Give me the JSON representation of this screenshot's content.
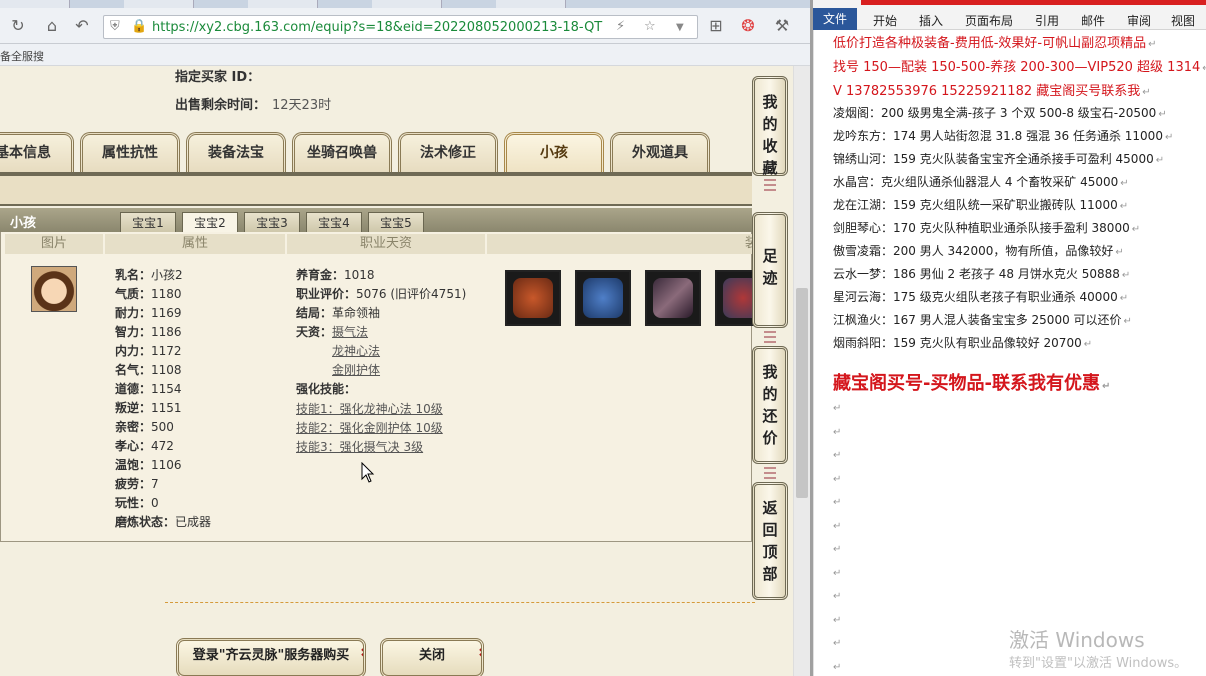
{
  "browser": {
    "url": "https://xy2.cbg.163.com/equip?s=18&eid=202208052000213-18-QT",
    "bookmarks_label": "备全服搜"
  },
  "page": {
    "seller_id_label": "指定买家 ID：",
    "sale_time_label": "出售剩余时间：",
    "sale_time_value": "12天23时",
    "main_tabs": [
      "基本信息",
      "属性抗性",
      "装备法宝",
      "坐骑召唤兽",
      "法术修正",
      "小孩",
      "外观道具"
    ],
    "active_tab": "小孩",
    "child_section_title": "小孩",
    "baby_tabs": [
      "宝宝1",
      "宝宝2",
      "宝宝3",
      "宝宝4",
      "宝宝5"
    ],
    "active_baby_tab": "宝宝2",
    "columns": {
      "picture": "图片",
      "attributes": "属性",
      "career": "职业天资",
      "equipment": "装备"
    },
    "attributes": [
      {
        "label": "乳名：",
        "value": "小孩2"
      },
      {
        "label": "气质：",
        "value": "1180"
      },
      {
        "label": "耐力：",
        "value": "1169"
      },
      {
        "label": "智力：",
        "value": "1186"
      },
      {
        "label": "内力：",
        "value": "1172"
      },
      {
        "label": "名气：",
        "value": "1108"
      },
      {
        "label": "道德：",
        "value": "1154"
      },
      {
        "label": "叛逆：",
        "value": "1151"
      },
      {
        "label": "亲密：",
        "value": "500"
      },
      {
        "label": "孝心：",
        "value": "472"
      },
      {
        "label": "温饱：",
        "value": "1106"
      },
      {
        "label": "疲劳：",
        "value": "7"
      },
      {
        "label": "玩性：",
        "value": "0"
      },
      {
        "label": "磨炼状态：",
        "value": "已成器"
      }
    ],
    "career": {
      "raising_label": "养育金：",
      "raising_value": "1018",
      "rating_label": "职业评价：",
      "rating_value": "5076 (旧评价4751)",
      "ending_label": "结局：",
      "ending_value": "革命领袖",
      "talent_label": "天资：",
      "talents": [
        "摄气法",
        "龙神心法",
        "金刚护体"
      ],
      "skills_label": "强化技能：",
      "skills": [
        "技能1：强化龙神心法 10级",
        "技能2：强化金刚护体 10级",
        "技能3：强化摄气决 3级"
      ]
    },
    "equipment_icons": [
      "armor-icon",
      "robe-icon",
      "instrument-icon",
      "chest-icon"
    ],
    "buttons": {
      "buy": "登录\"齐云灵脉\"服务器购买",
      "close": "关闭"
    },
    "side_buttons": [
      "我的收藏",
      "足迹",
      "我的还价",
      "返回顶部"
    ]
  },
  "word": {
    "ribbon_tabs": [
      "文件",
      "开始",
      "插入",
      "页面布局",
      "引用",
      "邮件",
      "审阅",
      "视图"
    ],
    "lines": [
      {
        "text": "低价打造各种极装备-费用低-效果好-可帆山副忍项精品",
        "style": "red"
      },
      {
        "text": "找号 150—配装 150-500-养孩 200-300—VIP520 超级 1314",
        "style": "red"
      },
      {
        "text": "V 13782553976     15225921182   藏宝阁买号联系我",
        "style": "red"
      },
      {
        "text": "凌烟阁：200 级男鬼全满-孩子 3 个双 500-8 级宝石-20500",
        "style": "normal"
      },
      {
        "text": "龙吟东方：174 男人站街忽混 31.8 强混 36 任务通杀 11000",
        "style": "normal"
      },
      {
        "text": "锦绣山河：159 克火队装备宝宝齐全通杀接手可盈利 45000",
        "style": "normal"
      },
      {
        "text": "水晶宫：克火组队通杀仙器混人 4 个畜牧采矿 45000",
        "style": "normal"
      },
      {
        "text": "龙在江湖：159 克火组队统一采矿职业搬砖队 11000",
        "style": "normal"
      },
      {
        "text": "剑胆琴心：170 克火队种植职业通杀队接手盈利 38000",
        "style": "normal"
      },
      {
        "text": "傲雪凌霜：200 男人 342000，物有所值，品像较好",
        "style": "normal"
      },
      {
        "text": "云水一梦：186 男仙 2 老孩子 48 月饼水克火 50888",
        "style": "normal"
      },
      {
        "text": "星河云海：175 级克火组队老孩子有职业通杀 40000",
        "style": "normal"
      },
      {
        "text": "江枫渔火：167 男人混人装备宝宝多 25000 可以还价",
        "style": "normal"
      },
      {
        "text": "烟雨斜阳：159 克火队有职业品像较好 20700",
        "style": "normal"
      },
      {
        "text": "藏宝阁买号-买物品-联系我有优惠",
        "style": "bigred"
      }
    ],
    "watermark": "激活 Windows",
    "watermark_sub": "转到\"设置\"以激活 Windows。"
  },
  "colors": {
    "accent_red": "#d4161c",
    "url_green": "#1a8a3a",
    "ribbon_blue": "#2b579a"
  }
}
